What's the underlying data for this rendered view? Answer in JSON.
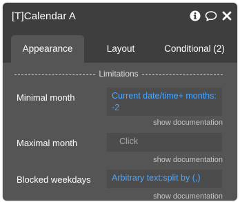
{
  "window": {
    "title": "[T]Calendar A",
    "icons": [
      "info-icon",
      "comment-icon",
      "close-icon"
    ]
  },
  "tabs": [
    {
      "label": "Appearance",
      "active": true
    },
    {
      "label": "Layout",
      "active": false
    },
    {
      "label": "Conditional (2)",
      "active": false
    }
  ],
  "section": {
    "title": "Limitations"
  },
  "properties": [
    {
      "label": "Minimal month",
      "value": "Current date/time+ months: -2",
      "doc": "show documentation"
    },
    {
      "label": "Maximal month",
      "value": "",
      "placeholder": "Click",
      "doc": "show documentation"
    },
    {
      "label": "Blocked weekdays",
      "value": "Arbitrary text:split by (,)",
      "doc": "show documentation"
    }
  ],
  "colors": {
    "panel_bg": "#3e3e3e",
    "content_bg": "#555555",
    "field_bg": "#4c4c4c",
    "dynamic_value": "#4aa6ff"
  }
}
